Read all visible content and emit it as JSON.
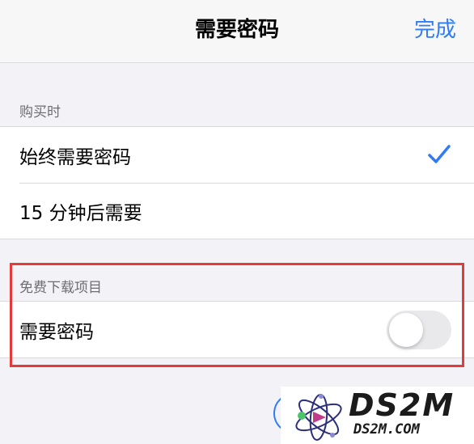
{
  "nav": {
    "title": "需要密码",
    "done_label": "完成"
  },
  "purchase_section": {
    "header": "购买时",
    "options": [
      {
        "label": "始终需要密码",
        "selected": true
      },
      {
        "label": "15 分钟后需要",
        "selected": false
      }
    ]
  },
  "free_downloads_section": {
    "header": "免费下载项目",
    "require_password": {
      "label": "需要密码",
      "enabled": false
    }
  },
  "watermark": {
    "brand": "DS2M",
    "site": "DS2M.COM"
  },
  "colors": {
    "accent": "#2f7cf6",
    "highlight": "#e53a3a"
  }
}
